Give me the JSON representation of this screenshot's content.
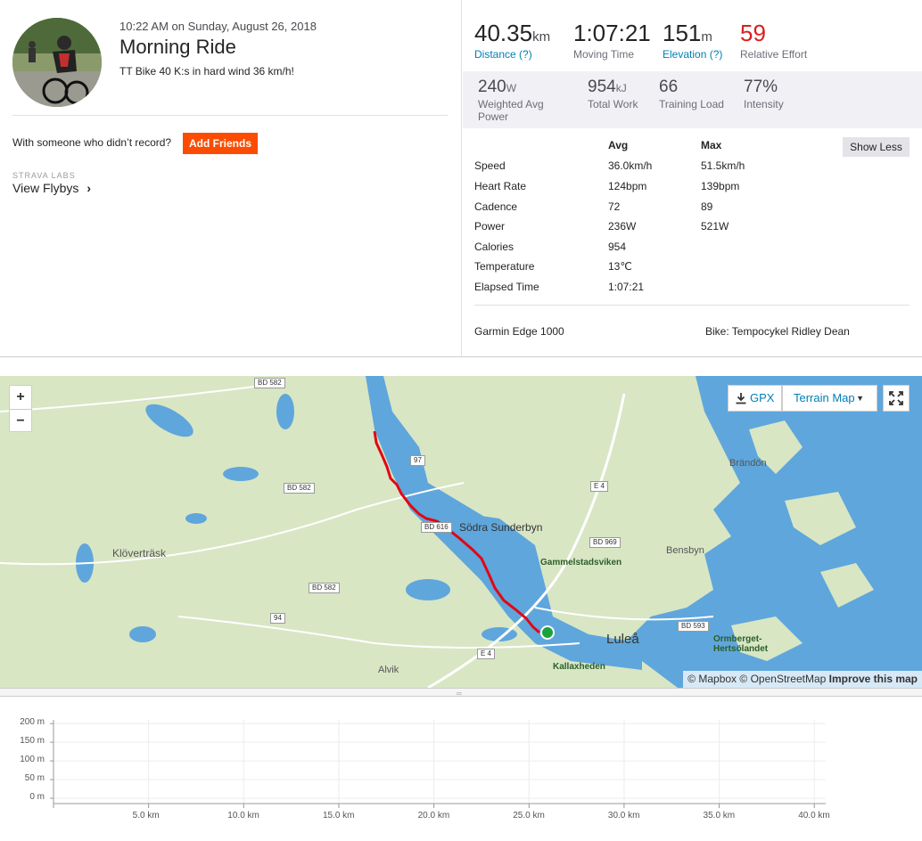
{
  "activity": {
    "datetime": "10:22 AM on Sunday, August 26, 2018",
    "title": "Morning Ride",
    "description": "TT Bike 40 K:s in hard wind 36 km/h!"
  },
  "social": {
    "with_text": "With someone who didn’t record?",
    "add_friends_label": "Add Friends",
    "labs_label": "STRAVA LABS",
    "flybys_label": "View Flybys"
  },
  "primary_stats": [
    {
      "value": "40.35",
      "unit": "km",
      "label": "Distance (?)",
      "link": true
    },
    {
      "value": "1:07:21",
      "unit": "",
      "label": "Moving Time",
      "link": false
    },
    {
      "value": "151",
      "unit": "m",
      "label": "Elevation (?)",
      "link": true
    },
    {
      "value": "59",
      "unit": "",
      "label": "Relative Effort",
      "link": false
    }
  ],
  "secondary_stats": [
    {
      "value": "240",
      "unit": "W",
      "label": "Weighted Avg Power"
    },
    {
      "value": "954",
      "unit": "kJ",
      "label": "Total Work"
    },
    {
      "value": "66",
      "unit": "",
      "label": "Training Load"
    },
    {
      "value": "77%",
      "unit": "",
      "label": "Intensity"
    }
  ],
  "table": {
    "col_avg": "Avg",
    "col_max": "Max",
    "show_less_label": "Show Less",
    "rows": [
      {
        "name": "Speed",
        "avg": "36.0km/h",
        "max": "51.5km/h"
      },
      {
        "name": "Heart Rate",
        "avg": "124bpm",
        "max": "139bpm"
      },
      {
        "name": "Cadence",
        "avg": "72",
        "max": "89"
      },
      {
        "name": "Power",
        "avg": "236W",
        "max": "521W"
      },
      {
        "name": "Calories",
        "avg": "954",
        "max": ""
      },
      {
        "name": "Temperature",
        "avg": "13℃",
        "max": ""
      },
      {
        "name": "Elapsed Time",
        "avg": "1:07:21",
        "max": ""
      }
    ]
  },
  "gear": {
    "device": "Garmin Edge 1000",
    "bike": "Bike: Tempocykel Ridley Dean"
  },
  "map": {
    "zoom_in": "+",
    "zoom_out": "−",
    "gpx_label": "GPX",
    "map_type_label": "Terrain Map",
    "attribution_mapbox": "© Mapbox",
    "attribution_osm": "© OpenStreetMap",
    "attribution_improve": "Improve this map",
    "labels": {
      "kloverstrask": "Klöverträsk",
      "sodra": "Södra Sunderbyn",
      "gammelstad": "Gammelstadsviken",
      "bensbyn": "Bensbyn",
      "brandon": "Brändön",
      "lulea": "Luleå",
      "ormberget": "Ormberget-Hertsölandet",
      "kallaxheden": "Kallaxheden",
      "alvik": "Alvik"
    },
    "road_shields": {
      "bd582a": "BD 582",
      "bd582b": "BD 582",
      "bd582c": "BD 582",
      "r97": "97",
      "e4a": "E 4",
      "e4b": "E 4",
      "bd616": "BD 616",
      "bd969": "BD 969",
      "bd593": "BD 593",
      "r94": "94"
    },
    "colors": {
      "route": "#e30613",
      "water": "#5fa6dc",
      "land": "#d8e6c4",
      "marker": "#1aa33c"
    }
  },
  "chart_data": {
    "type": "area",
    "title": "",
    "xlabel": "",
    "ylabel": "",
    "x_ticks": [
      "5.0 km",
      "10.0 km",
      "15.0 km",
      "20.0 km",
      "25.0 km",
      "30.0 km",
      "35.0 km",
      "40.0 km"
    ],
    "y_ticks": [
      "200 m",
      "150 m",
      "100 m",
      "50 m",
      "0 m"
    ],
    "xlim": [
      0,
      40.35
    ],
    "ylim": [
      0,
      200
    ],
    "grid": true,
    "series": []
  }
}
